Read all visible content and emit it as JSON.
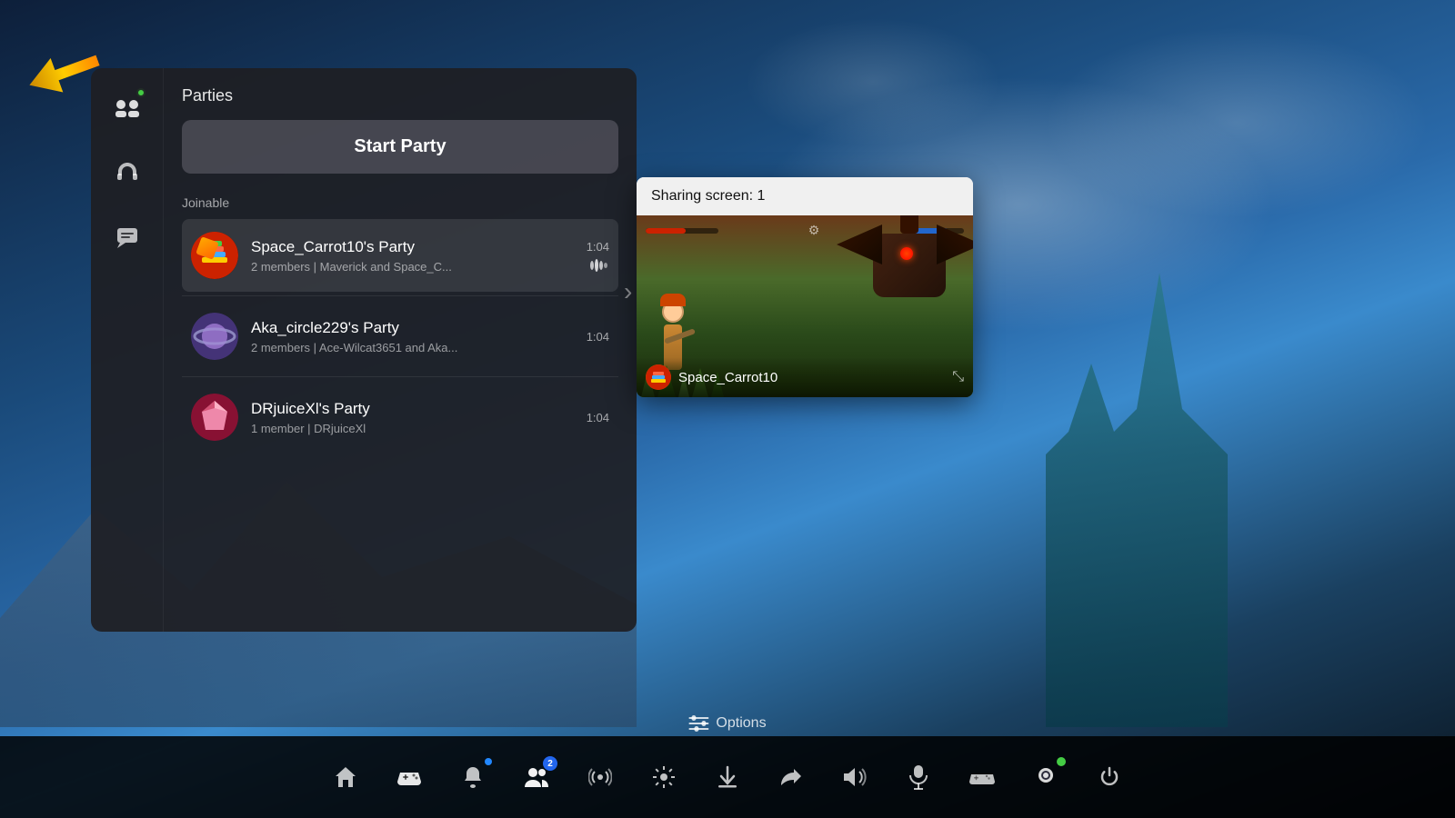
{
  "background": {
    "gradient_start": "#0d1f3a",
    "gradient_end": "#1a4060"
  },
  "panel": {
    "title": "Parties",
    "start_party_label": "Start Party",
    "joinable_label": "Joinable",
    "parties": [
      {
        "id": "space_carrot",
        "name": "Space_Carrot10's Party",
        "members": "2 members | Maverick and Space_C...",
        "time": "1:04",
        "has_live": true,
        "selected": true
      },
      {
        "id": "aka_circle",
        "name": "Aka_circle229's Party",
        "members": "2 members | Ace-Wilcat3651 and Aka...",
        "time": "1:04",
        "has_live": false,
        "selected": false
      },
      {
        "id": "drjuice",
        "name": "DRjuiceXl's Party",
        "members": "1 member | DRjuiceXl",
        "time": "1:04",
        "has_live": false,
        "selected": false
      }
    ]
  },
  "sharing_popup": {
    "header": "Sharing screen: 1",
    "username": "Space_Carrot10"
  },
  "options_bar": {
    "label": "Options"
  },
  "sidebar": {
    "icons": [
      "party-icon",
      "headset-icon",
      "chat-icon"
    ]
  },
  "taskbar": {
    "icons": [
      {
        "name": "home-icon",
        "symbol": "⌂",
        "badge": null
      },
      {
        "name": "game-icon",
        "symbol": "🎮",
        "badge": null
      },
      {
        "name": "notification-icon",
        "symbol": "🔔",
        "badge": "dot"
      },
      {
        "name": "friends-icon",
        "symbol": "👥",
        "badge": "2"
      },
      {
        "name": "broadcast-icon",
        "symbol": "📡",
        "badge": null
      },
      {
        "name": "settings-icon",
        "symbol": "⚙",
        "badge": null
      },
      {
        "name": "download-icon",
        "symbol": "⬇",
        "badge": null
      },
      {
        "name": "share-icon",
        "symbol": "📶",
        "badge": null
      },
      {
        "name": "volume-icon",
        "symbol": "🔊",
        "badge": null
      },
      {
        "name": "mic-icon",
        "symbol": "🎤",
        "badge": null
      },
      {
        "name": "controller-icon",
        "symbol": "🕹",
        "badge": null
      },
      {
        "name": "trophy-icon",
        "symbol": "😊",
        "badge": "green-dot"
      },
      {
        "name": "power-icon",
        "symbol": "⏻",
        "badge": null
      }
    ]
  }
}
